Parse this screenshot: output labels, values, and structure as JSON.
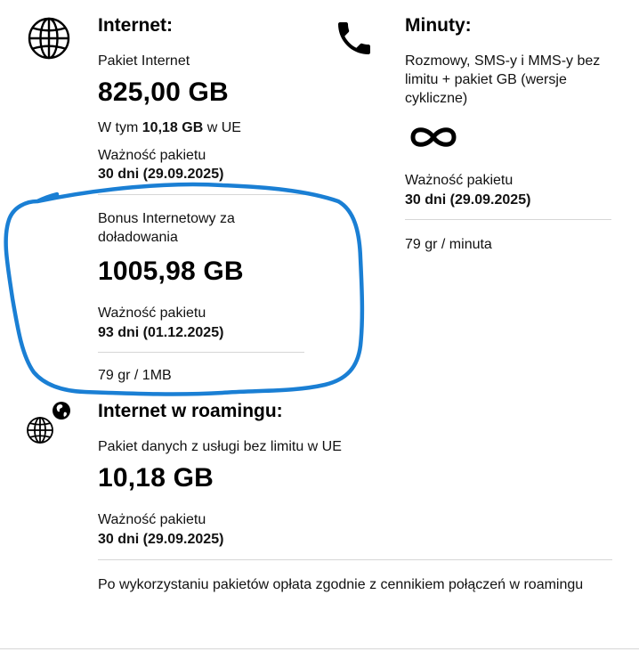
{
  "colors": {
    "annotation": "#1a7fd4",
    "divider": "#d6d6d6",
    "text": "#000000"
  },
  "internet": {
    "icon": "globe-icon",
    "title": "Internet:",
    "package_label": "Pakiet Internet",
    "package_amount": "825,00 GB",
    "eu_prefix": "W tym ",
    "eu_amount": "10,18 GB",
    "eu_suffix": " w UE",
    "validity_label": "Ważność pakietu",
    "validity_value": "30 dni (29.09.2025)",
    "bonus_label": "Bonus Internetowy za doładowania",
    "bonus_amount": "1005,98 GB",
    "bonus_validity_label": "Ważność pakietu",
    "bonus_validity_value": "93 dni (01.12.2025)",
    "rate": "79 gr / 1MB"
  },
  "minutes": {
    "icon": "phone-icon",
    "title": "Minuty:",
    "description": "Rozmowy, SMS-y i MMS-y bez limitu + pakiet GB (wersje cykliczne)",
    "unlimited_icon": "infinity-icon",
    "validity_label": "Ważność pakietu",
    "validity_value": "30 dni (29.09.2025)",
    "rate": "79 gr / minuta"
  },
  "roaming": {
    "icon": "globe-roaming-icon",
    "title": "Internet w roamingu:",
    "package_label": "Pakiet danych z usługi bez limitu w UE",
    "package_amount": "10,18 GB",
    "validity_label": "Ważność pakietu",
    "validity_value": "30 dni (29.09.2025)",
    "note": "Po wykorzystaniu pakietów opłata zgodnie z cennikiem połączeń w roamingu"
  }
}
